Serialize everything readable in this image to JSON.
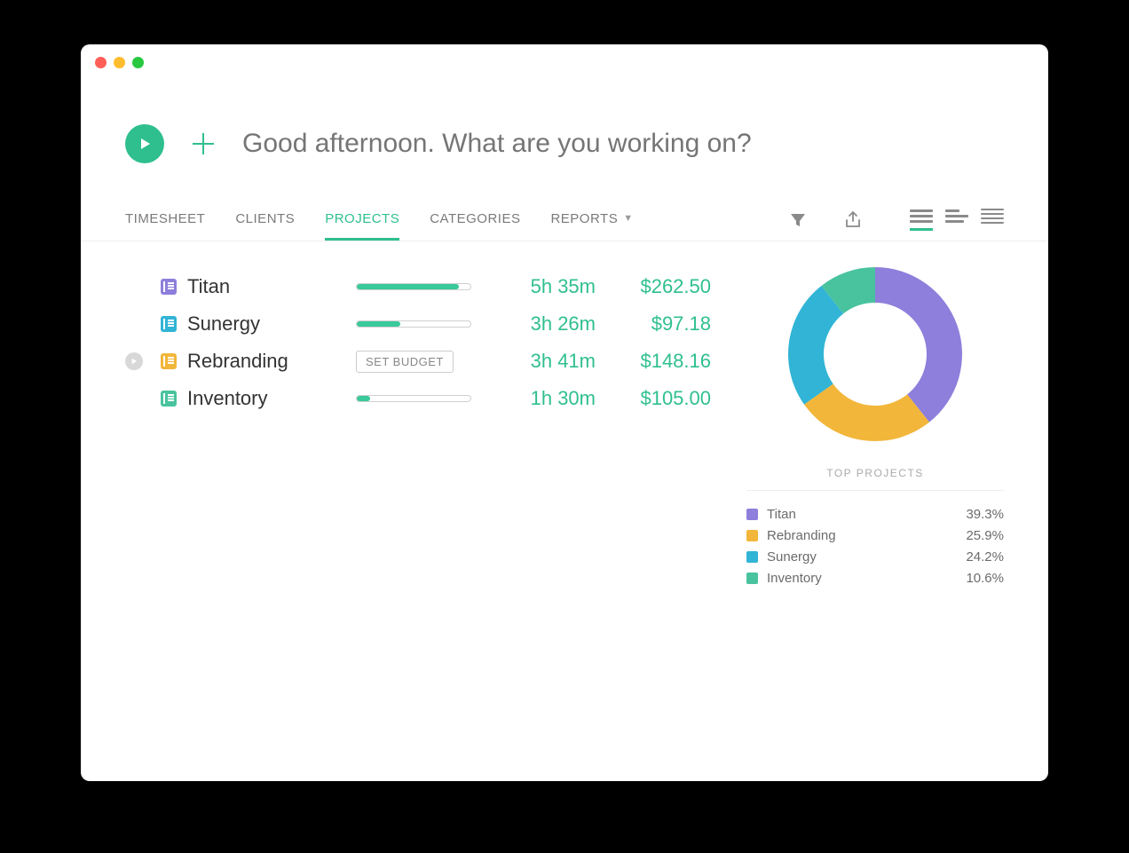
{
  "header": {
    "prompt_placeholder": "Good afternoon. What are you working on?"
  },
  "tabs": {
    "items": [
      {
        "label": "TIMESHEET",
        "active": false
      },
      {
        "label": "CLIENTS",
        "active": false
      },
      {
        "label": "PROJECTS",
        "active": true
      },
      {
        "label": "CATEGORIES",
        "active": false
      },
      {
        "label": "REPORTS",
        "active": false,
        "dropdown": true
      }
    ]
  },
  "projects": [
    {
      "name": "Titan",
      "color": "#8d7fdb",
      "progress": 90,
      "duration": "5h 35m",
      "amount": "$262.50",
      "budget": true,
      "hover": false
    },
    {
      "name": "Sunergy",
      "color": "#31b4d6",
      "progress": 38,
      "duration": "3h 26m",
      "amount": "$97.18",
      "budget": true,
      "hover": false
    },
    {
      "name": "Rebranding",
      "color": "#f2b63a",
      "progress": 0,
      "duration": "3h 41m",
      "amount": "$148.16",
      "budget": false,
      "budget_label": "SET BUDGET",
      "hover": true
    },
    {
      "name": "Inventory",
      "color": "#49c39e",
      "progress": 12,
      "duration": "1h 30m",
      "amount": "$105.00",
      "budget": true,
      "hover": false
    }
  ],
  "chart": {
    "title": "TOP PROJECTS",
    "legend": [
      {
        "name": "Titan",
        "pct": "39.3%",
        "color": "#8d7fdb"
      },
      {
        "name": "Rebranding",
        "pct": "25.9%",
        "color": "#f2b63a"
      },
      {
        "name": "Sunergy",
        "pct": "24.2%",
        "color": "#31b4d6"
      },
      {
        "name": "Inventory",
        "pct": "10.6%",
        "color": "#49c39e"
      }
    ]
  },
  "chart_data": {
    "type": "pie",
    "title": "TOP PROJECTS",
    "series": [
      {
        "name": "Titan",
        "value": 39.3,
        "color": "#8d7fdb"
      },
      {
        "name": "Rebranding",
        "value": 25.9,
        "color": "#f2b63a"
      },
      {
        "name": "Sunergy",
        "value": 24.2,
        "color": "#31b4d6"
      },
      {
        "name": "Inventory",
        "value": 10.6,
        "color": "#49c39e"
      }
    ]
  }
}
